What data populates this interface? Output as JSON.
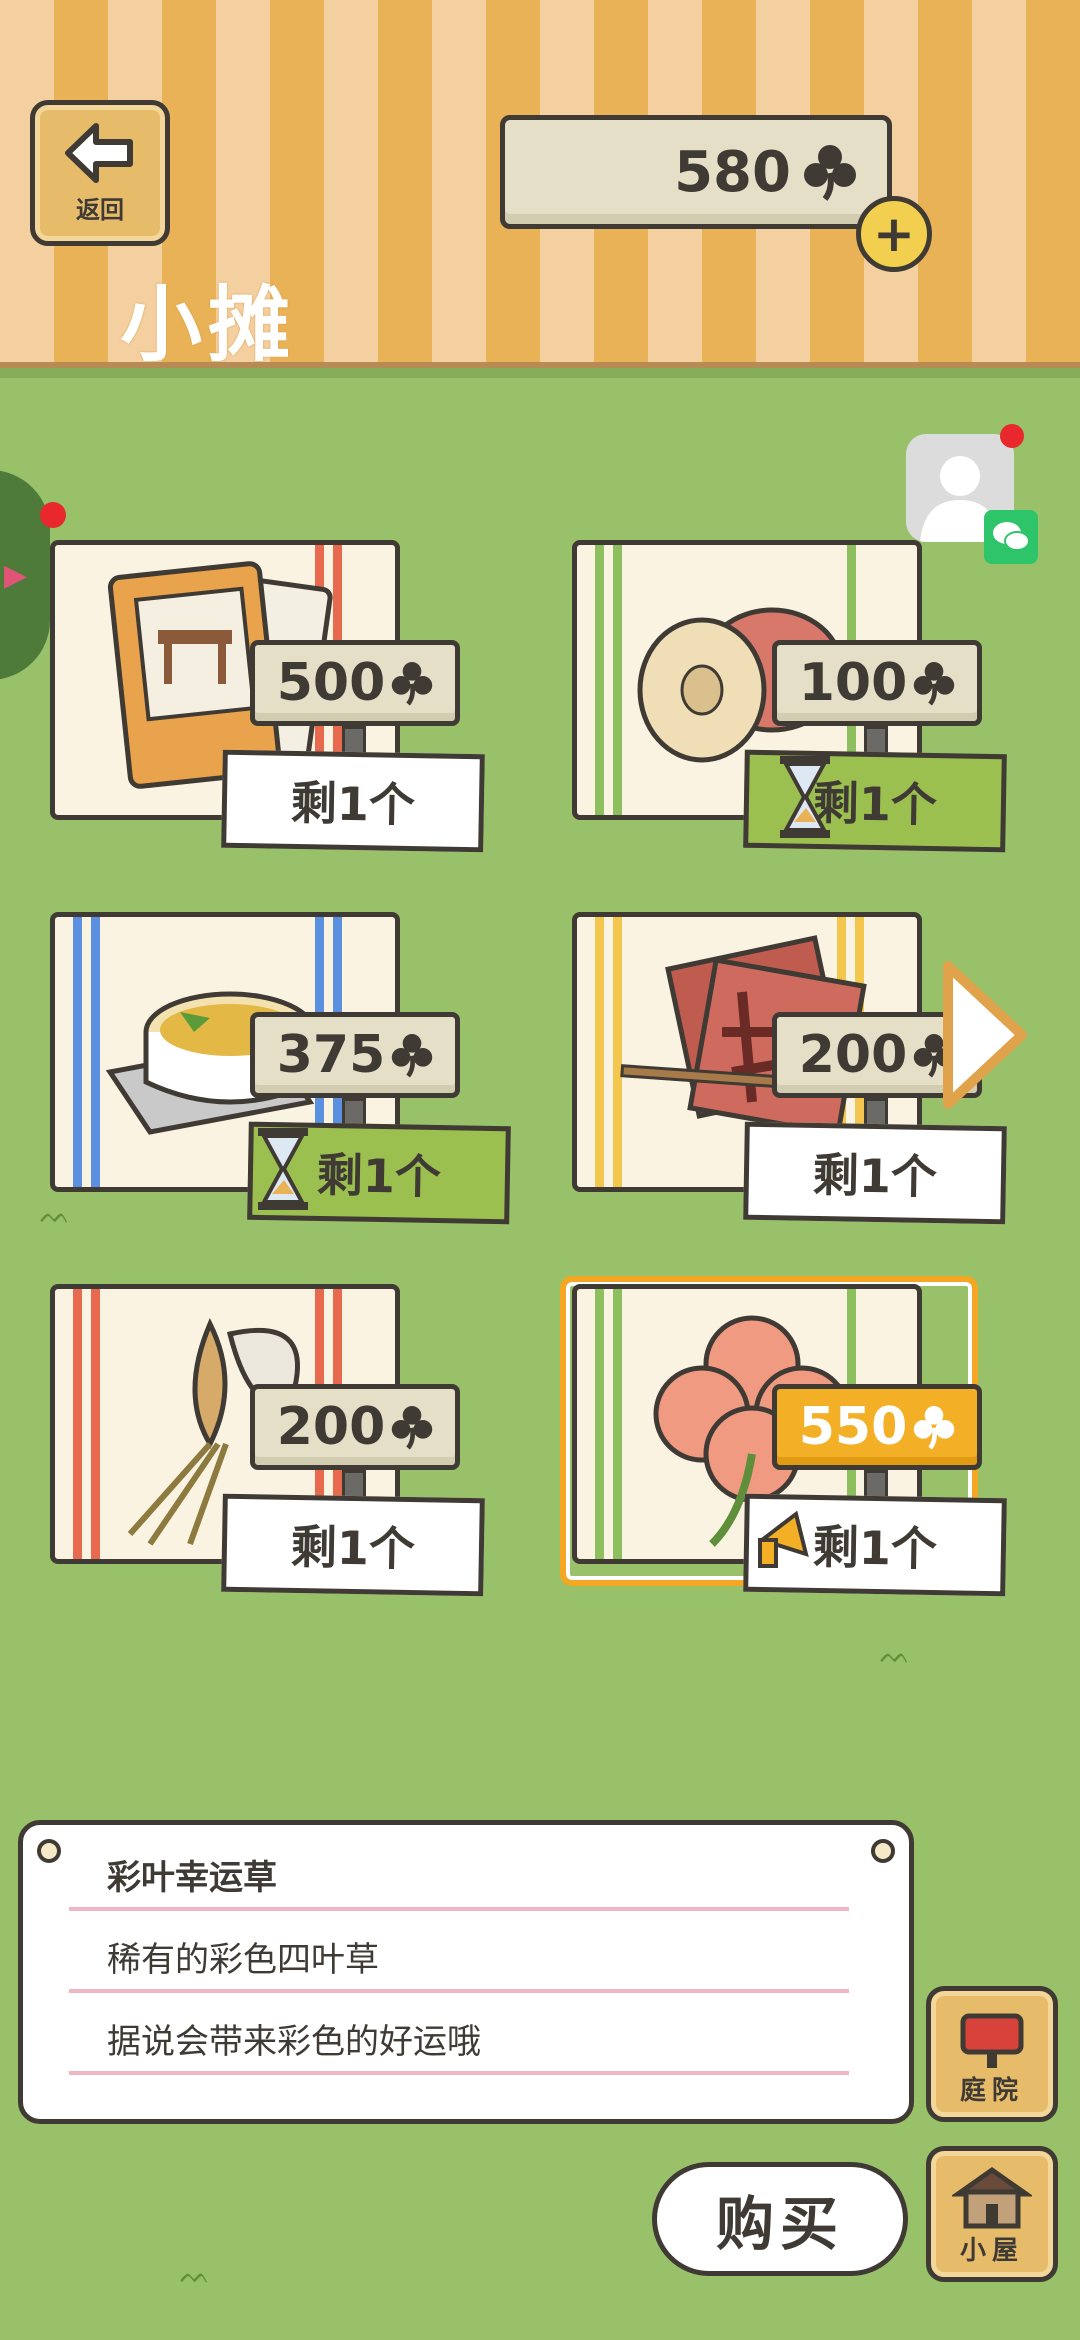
{
  "header": {
    "back_label": "返回",
    "title": "小摊",
    "clover_balance": "580"
  },
  "items": [
    {
      "price": "500",
      "stock": "剩1个",
      "illustration": "furniture-book-icon",
      "stripe_color": "#e86a4e",
      "timed": false
    },
    {
      "price": "100",
      "stock": "剩1个",
      "illustration": "bread-roll-icon",
      "stripe_color": "#8dbf5e",
      "timed": true
    },
    {
      "price": "375",
      "stock": "剩1个",
      "illustration": "stew-pot-icon",
      "stripe_color": "#5b8fe0",
      "timed": true
    },
    {
      "price": "200",
      "stock": "剩1个",
      "illustration": "calligraphy-paper-icon",
      "stripe_color": "#f3c74e",
      "timed": false
    },
    {
      "price": "200",
      "stock": "剩1个",
      "illustration": "grass-bundle-icon",
      "stripe_color": "#e86a4e",
      "timed": false
    },
    {
      "price": "550",
      "stock": "剩1个",
      "illustration": "four-leaf-clover-icon",
      "stripe_color": "#8dbf5e",
      "timed": false,
      "selected": true
    }
  ],
  "description": {
    "name": "彩叶幸运草",
    "line1": "稀有的彩色四叶草",
    "line2": "据说会带来彩色的好运哦"
  },
  "buttons": {
    "buy": "购买",
    "yard": "庭院",
    "house": "小屋"
  },
  "colors": {
    "grass": "#98c16a",
    "selected_border": "#f5a623",
    "gold_tag": "#f3b027"
  }
}
